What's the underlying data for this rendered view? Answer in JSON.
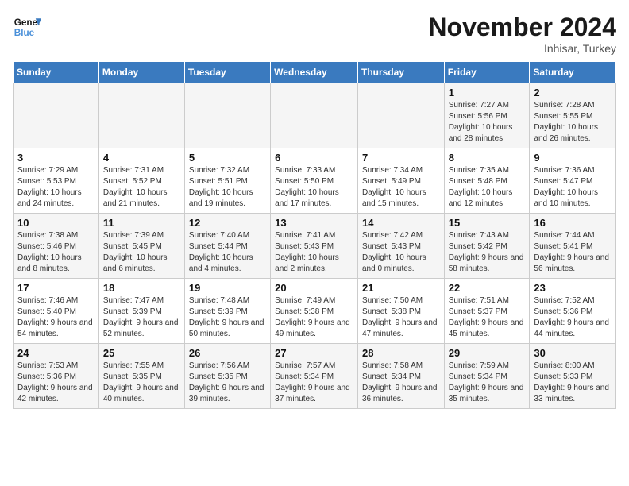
{
  "header": {
    "logo_line1": "General",
    "logo_line2": "Blue",
    "month": "November 2024",
    "location": "Inhisar, Turkey"
  },
  "days_of_week": [
    "Sunday",
    "Monday",
    "Tuesday",
    "Wednesday",
    "Thursday",
    "Friday",
    "Saturday"
  ],
  "weeks": [
    [
      {
        "day": "",
        "info": ""
      },
      {
        "day": "",
        "info": ""
      },
      {
        "day": "",
        "info": ""
      },
      {
        "day": "",
        "info": ""
      },
      {
        "day": "",
        "info": ""
      },
      {
        "day": "1",
        "info": "Sunrise: 7:27 AM\nSunset: 5:56 PM\nDaylight: 10 hours and 28 minutes."
      },
      {
        "day": "2",
        "info": "Sunrise: 7:28 AM\nSunset: 5:55 PM\nDaylight: 10 hours and 26 minutes."
      }
    ],
    [
      {
        "day": "3",
        "info": "Sunrise: 7:29 AM\nSunset: 5:53 PM\nDaylight: 10 hours and 24 minutes."
      },
      {
        "day": "4",
        "info": "Sunrise: 7:31 AM\nSunset: 5:52 PM\nDaylight: 10 hours and 21 minutes."
      },
      {
        "day": "5",
        "info": "Sunrise: 7:32 AM\nSunset: 5:51 PM\nDaylight: 10 hours and 19 minutes."
      },
      {
        "day": "6",
        "info": "Sunrise: 7:33 AM\nSunset: 5:50 PM\nDaylight: 10 hours and 17 minutes."
      },
      {
        "day": "7",
        "info": "Sunrise: 7:34 AM\nSunset: 5:49 PM\nDaylight: 10 hours and 15 minutes."
      },
      {
        "day": "8",
        "info": "Sunrise: 7:35 AM\nSunset: 5:48 PM\nDaylight: 10 hours and 12 minutes."
      },
      {
        "day": "9",
        "info": "Sunrise: 7:36 AM\nSunset: 5:47 PM\nDaylight: 10 hours and 10 minutes."
      }
    ],
    [
      {
        "day": "10",
        "info": "Sunrise: 7:38 AM\nSunset: 5:46 PM\nDaylight: 10 hours and 8 minutes."
      },
      {
        "day": "11",
        "info": "Sunrise: 7:39 AM\nSunset: 5:45 PM\nDaylight: 10 hours and 6 minutes."
      },
      {
        "day": "12",
        "info": "Sunrise: 7:40 AM\nSunset: 5:44 PM\nDaylight: 10 hours and 4 minutes."
      },
      {
        "day": "13",
        "info": "Sunrise: 7:41 AM\nSunset: 5:43 PM\nDaylight: 10 hours and 2 minutes."
      },
      {
        "day": "14",
        "info": "Sunrise: 7:42 AM\nSunset: 5:43 PM\nDaylight: 10 hours and 0 minutes."
      },
      {
        "day": "15",
        "info": "Sunrise: 7:43 AM\nSunset: 5:42 PM\nDaylight: 9 hours and 58 minutes."
      },
      {
        "day": "16",
        "info": "Sunrise: 7:44 AM\nSunset: 5:41 PM\nDaylight: 9 hours and 56 minutes."
      }
    ],
    [
      {
        "day": "17",
        "info": "Sunrise: 7:46 AM\nSunset: 5:40 PM\nDaylight: 9 hours and 54 minutes."
      },
      {
        "day": "18",
        "info": "Sunrise: 7:47 AM\nSunset: 5:39 PM\nDaylight: 9 hours and 52 minutes."
      },
      {
        "day": "19",
        "info": "Sunrise: 7:48 AM\nSunset: 5:39 PM\nDaylight: 9 hours and 50 minutes."
      },
      {
        "day": "20",
        "info": "Sunrise: 7:49 AM\nSunset: 5:38 PM\nDaylight: 9 hours and 49 minutes."
      },
      {
        "day": "21",
        "info": "Sunrise: 7:50 AM\nSunset: 5:38 PM\nDaylight: 9 hours and 47 minutes."
      },
      {
        "day": "22",
        "info": "Sunrise: 7:51 AM\nSunset: 5:37 PM\nDaylight: 9 hours and 45 minutes."
      },
      {
        "day": "23",
        "info": "Sunrise: 7:52 AM\nSunset: 5:36 PM\nDaylight: 9 hours and 44 minutes."
      }
    ],
    [
      {
        "day": "24",
        "info": "Sunrise: 7:53 AM\nSunset: 5:36 PM\nDaylight: 9 hours and 42 minutes."
      },
      {
        "day": "25",
        "info": "Sunrise: 7:55 AM\nSunset: 5:35 PM\nDaylight: 9 hours and 40 minutes."
      },
      {
        "day": "26",
        "info": "Sunrise: 7:56 AM\nSunset: 5:35 PM\nDaylight: 9 hours and 39 minutes."
      },
      {
        "day": "27",
        "info": "Sunrise: 7:57 AM\nSunset: 5:34 PM\nDaylight: 9 hours and 37 minutes."
      },
      {
        "day": "28",
        "info": "Sunrise: 7:58 AM\nSunset: 5:34 PM\nDaylight: 9 hours and 36 minutes."
      },
      {
        "day": "29",
        "info": "Sunrise: 7:59 AM\nSunset: 5:34 PM\nDaylight: 9 hours and 35 minutes."
      },
      {
        "day": "30",
        "info": "Sunrise: 8:00 AM\nSunset: 5:33 PM\nDaylight: 9 hours and 33 minutes."
      }
    ]
  ]
}
